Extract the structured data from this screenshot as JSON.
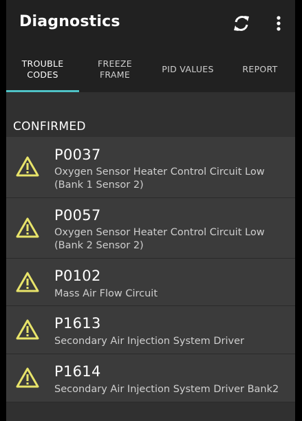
{
  "toolbar": {
    "title": "Diagnostics",
    "refresh_icon": "refresh-icon",
    "more_icon": "more-vert-icon"
  },
  "tabs": [
    {
      "label": "TROUBLE\nCODES",
      "active": true
    },
    {
      "label": "FREEZE\nFRAME",
      "active": false
    },
    {
      "label": "PID VALUES",
      "active": false
    },
    {
      "label": "REPORT",
      "active": false
    }
  ],
  "section": {
    "title": "CONFIRMED"
  },
  "codes": [
    {
      "code": "P0037",
      "description": "Oxygen Sensor Heater Control Circuit Low (Bank 1 Sensor 2)",
      "icon": "warning-icon"
    },
    {
      "code": "P0057",
      "description": "Oxygen Sensor Heater Control Circuit Low (Bank 2 Sensor 2)",
      "icon": "warning-icon"
    },
    {
      "code": "P0102",
      "description": "Mass Air Flow Circuit",
      "icon": "warning-icon"
    },
    {
      "code": "P1613",
      "description": "Secondary Air Injection System Driver",
      "icon": "warning-icon"
    },
    {
      "code": "P1614",
      "description": "Secondary Air Injection System Driver Bank2",
      "icon": "warning-icon"
    }
  ],
  "colors": {
    "background": "#303030",
    "toolbar": "#212121",
    "row": "#3b3b3b",
    "accent": "#4fc3c7",
    "warning": "#e8e46a"
  }
}
